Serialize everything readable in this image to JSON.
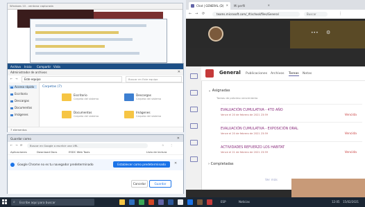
{
  "thumbnail": {
    "title": "Windows 10 - ventana capturada"
  },
  "explorer": {
    "ribbon_tabs": [
      "Archivo",
      "Inicio",
      "Compartir",
      "Vista"
    ],
    "window_title": "Administrador de archivos",
    "address": "Este equipo",
    "search_placeholder": "Buscar en Este equipo",
    "sidebar": [
      "Acceso rápido",
      "Escritorio",
      "Descargas",
      "Documentos",
      "Imágenes"
    ],
    "group_label": "Carpetas (7)",
    "folders": [
      {
        "name": "Escritorio",
        "sub": "Carpeta del sistema"
      },
      {
        "name": "Descargas",
        "sub": "Carpeta del sistema"
      },
      {
        "name": "Documentos",
        "sub": "Carpeta del sistema"
      },
      {
        "name": "Imágenes",
        "sub": "Carpeta del sistema"
      }
    ],
    "status": "7 elementos"
  },
  "downloads": {
    "tab_title": "Guardar como",
    "address": "Buscar en Google o escribir una URL",
    "bookmarks": [
      "Aplicaciones",
      "Download Docs",
      "ESDC Web Tools",
      "Lista de lectura"
    ],
    "banner_text": "Google Chrome no es tu navegador predeterminado",
    "banner_button": "Establecer como predeterminado",
    "cancel": "Cancelar",
    "save": "Guardar"
  },
  "browser": {
    "tab1_title": "Chat | GENERAL (D)",
    "tab2_title": "Mi perfil",
    "url": "teams.microsoft.com/_#/school/files/General",
    "search_placeholder": "Buscar"
  },
  "teams": {
    "channel": "General",
    "tabs": [
      "Publicaciones",
      "Archivos",
      "Tareas",
      "Notas"
    ],
    "section_assigned": "Asignadas",
    "section_subtitle": "Tareas de próximo vencimiento",
    "tasks": [
      {
        "title": "EVALUACIÓN CUMULATIVA - 4TO AÑO",
        "due": "Vence el 20 de febrero de 2021 23:59",
        "status": "Vencida"
      },
      {
        "title": "EVALUACIÓN CUMULATIVA - EXPOSICIÓN ORAL",
        "due": "Vence el 20 de febrero de 2021 23:59",
        "status": "Vencida"
      },
      {
        "title": "ACTIVIDADES REFUERZO LOS HABITAT",
        "due": "Vence el 21 de febrero de 2021 23:59",
        "status": "Vencida"
      }
    ],
    "section_completed": "Completadas",
    "view_more": "Ver más"
  },
  "taskbar": {
    "search_placeholder": "Escribe aquí para buscar",
    "tray": [
      "ESP",
      "Noticias",
      "12:05",
      "15/02/2021"
    ]
  },
  "colors": {
    "teams_purple": "#6264a7",
    "overdue_red": "#c73b3b",
    "chrome_blue": "#1a73e8",
    "taskbar": "#1b2633"
  }
}
